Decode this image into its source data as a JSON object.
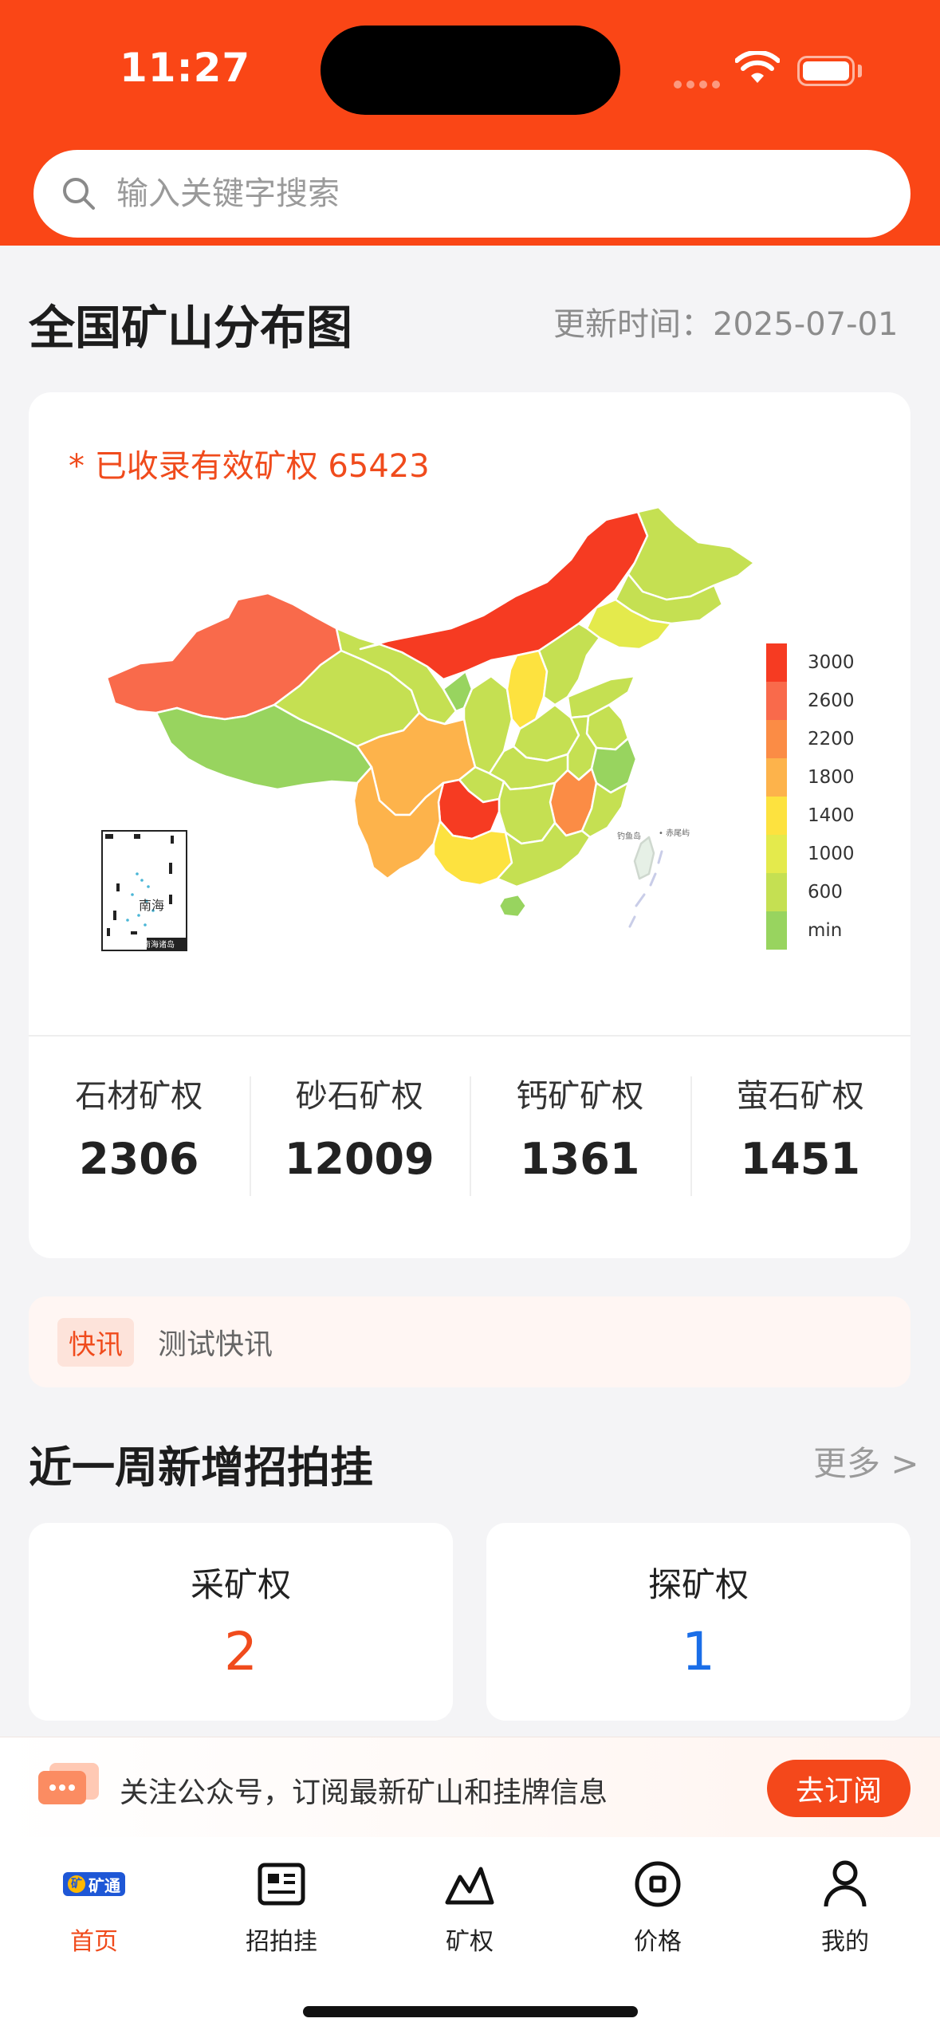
{
  "status_bar": {
    "time": "11:27"
  },
  "search": {
    "placeholder": "输入关键字搜索"
  },
  "map_section": {
    "title": "全国矿山分布图",
    "update_time": "更新时间：2025-07-01",
    "count_line": "* 已收录有效矿权 65423",
    "inset_label": "南海",
    "inset_caption": "南海诸岛",
    "legend": {
      "labels": [
        "3000",
        "2600",
        "2200",
        "1800",
        "1400",
        "1000",
        "600",
        "min"
      ],
      "colors": [
        "#f63b22",
        "#f96a4b",
        "#fb8c45",
        "#fdb34b",
        "#fde23f",
        "#e4ea4c",
        "#c5e052",
        "#98d45f"
      ]
    },
    "stats": [
      {
        "label": "石材矿权",
        "value": "2306"
      },
      {
        "label": "砂石矿权",
        "value": "12009"
      },
      {
        "label": "钙矿矿权",
        "value": "1361"
      },
      {
        "label": "萤石矿权",
        "value": "1451"
      }
    ]
  },
  "news": {
    "tag": "快讯",
    "text": "测试快讯"
  },
  "weekly": {
    "title": "近一周新增招拍挂",
    "more": "更多 >",
    "cards": [
      {
        "label": "采矿权",
        "value": "2",
        "color": "#f04b1c"
      },
      {
        "label": "探矿权",
        "value": "1",
        "color": "#1a6ee8"
      }
    ]
  },
  "subscribe": {
    "text": "关注公众号，订阅最新矿山和挂牌信息",
    "button": "去订阅"
  },
  "tabs": [
    {
      "label": "首页",
      "icon": "home-logo-icon",
      "active": true,
      "logo_text": "矿通"
    },
    {
      "label": "招拍挂",
      "icon": "id-card-icon",
      "active": false
    },
    {
      "label": "矿权",
      "icon": "mountain-icon",
      "active": false
    },
    {
      "label": "价格",
      "icon": "coin-icon",
      "active": false
    },
    {
      "label": "我的",
      "icon": "user-icon",
      "active": false
    }
  ],
  "colors": {
    "brand": "#fa4616",
    "accent_blue": "#1a6ee8"
  }
}
